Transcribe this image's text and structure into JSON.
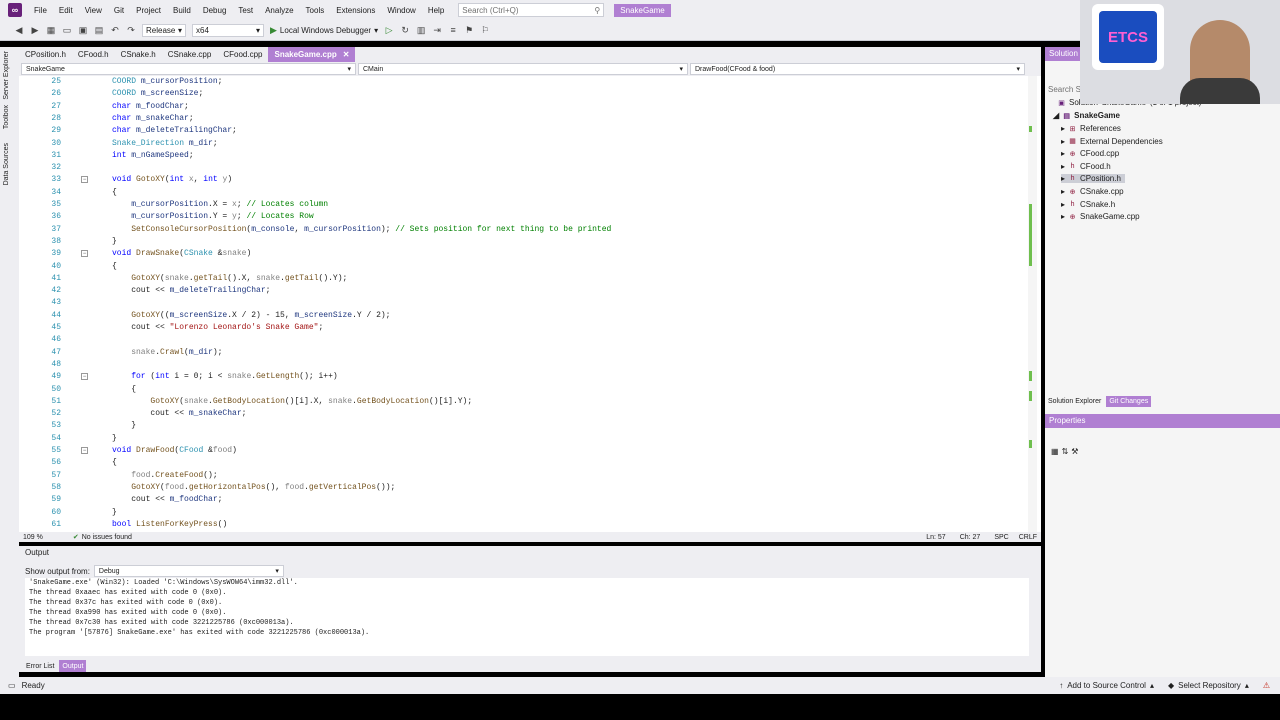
{
  "menu": [
    "File",
    "Edit",
    "View",
    "Git",
    "Project",
    "Build",
    "Debug",
    "Test",
    "Analyze",
    "Tools",
    "Extensions",
    "Window",
    "Help"
  ],
  "search_placeholder": "Search (Ctrl+Q)",
  "solution_name": "SnakeGame",
  "toolbar": {
    "config": "Release",
    "platform": "x64",
    "run_label": "Local Windows Debugger"
  },
  "left_tabs": [
    "Server Explorer",
    "Toolbox",
    "Data Sources"
  ],
  "tabs": [
    {
      "label": "CPosition.h",
      "active": false
    },
    {
      "label": "CFood.h",
      "active": false
    },
    {
      "label": "CSnake.h",
      "active": false
    },
    {
      "label": "CSnake.cpp",
      "active": false
    },
    {
      "label": "CFood.cpp",
      "active": false
    },
    {
      "label": "SnakeGame.cpp",
      "active": true
    }
  ],
  "navbar": {
    "project": "SnakeGame",
    "scope": "CMain",
    "member": "DrawFood(CFood & food)"
  },
  "code_lines": [
    {
      "n": "25",
      "html": "<span class=\"ty\">COORD</span> <span class=\"mb\">m_cursorPosition</span>;"
    },
    {
      "n": "26",
      "html": "<span class=\"ty\">COORD</span> <span class=\"mb\">m_screenSize</span>;"
    },
    {
      "n": "27",
      "html": "<span class=\"kw\">char</span> <span class=\"mb\">m_foodChar</span>;"
    },
    {
      "n": "28",
      "html": "<span class=\"kw\">char</span> <span class=\"mb\">m_snakeChar</span>;"
    },
    {
      "n": "29",
      "html": "<span class=\"kw\">char</span> <span class=\"mb\">m_deleteTrailingChar</span>;"
    },
    {
      "n": "30",
      "html": "<span class=\"ty\">Snake_Direction</span> <span class=\"mb\">m_dir</span>;"
    },
    {
      "n": "31",
      "html": "<span class=\"kw\">int</span> <span class=\"mb\">m_nGameSpeed</span>;"
    },
    {
      "n": "32",
      "html": ""
    },
    {
      "n": "33",
      "html": "<span class=\"kw\">void</span> <span class=\"fn\">GotoXY</span>(<span class=\"kw\">int</span> <span class=\"pm\">x</span>, <span class=\"kw\">int</span> <span class=\"pm\">y</span>)",
      "fold": true
    },
    {
      "n": "34",
      "html": "{"
    },
    {
      "n": "35",
      "html": "    <span class=\"mb\">m_cursorPosition</span>.X = <span class=\"pm\">x</span>; <span class=\"cm\">// Locates column</span>"
    },
    {
      "n": "36",
      "html": "    <span class=\"mb\">m_cursorPosition</span>.Y = <span class=\"pm\">y</span>; <span class=\"cm\">// Locates Row</span>"
    },
    {
      "n": "37",
      "html": "    <span class=\"fn\">SetConsoleCursorPosition</span>(<span class=\"mb\">m_console</span>, <span class=\"mb\">m_cursorPosition</span>); <span class=\"cm\">// Sets position for next thing to be printed</span>"
    },
    {
      "n": "38",
      "html": "}"
    },
    {
      "n": "39",
      "html": "<span class=\"kw\">void</span> <span class=\"fn\">DrawSnake</span>(<span class=\"ty\">CSnake</span> &amp;<span class=\"pm\">snake</span>)",
      "fold": true
    },
    {
      "n": "40",
      "html": "{"
    },
    {
      "n": "41",
      "html": "    <span class=\"fn\">GotoXY</span>(<span class=\"pm\">snake</span>.<span class=\"fn\">getTail</span>().X, <span class=\"pm\">snake</span>.<span class=\"fn\">getTail</span>().Y);"
    },
    {
      "n": "42",
      "html": "    cout &lt;&lt; <span class=\"mb\">m_deleteTrailingChar</span>;"
    },
    {
      "n": "43",
      "html": ""
    },
    {
      "n": "44",
      "html": "    <span class=\"fn\">GotoXY</span>((<span class=\"mb\">m_screenSize</span>.X / 2) - 15, <span class=\"mb\">m_screenSize</span>.Y / 2);"
    },
    {
      "n": "45",
      "html": "    cout &lt;&lt; <span class=\"str\">\"Lorenzo Leonardo's Snake Game\"</span>;"
    },
    {
      "n": "46",
      "html": ""
    },
    {
      "n": "47",
      "html": "    <span class=\"pm\">snake</span>.<span class=\"fn\">Crawl</span>(<span class=\"mb\">m_dir</span>);"
    },
    {
      "n": "48",
      "html": ""
    },
    {
      "n": "49",
      "html": "    <span class=\"kw\">for</span> (<span class=\"kw\">int</span> i = 0; i &lt; <span class=\"pm\">snake</span>.<span class=\"fn\">GetLength</span>(); i++)",
      "fold": true
    },
    {
      "n": "50",
      "html": "    {"
    },
    {
      "n": "51",
      "html": "        <span class=\"fn\">GotoXY</span>(<span class=\"pm\">snake</span>.<span class=\"fn\">GetBodyLocation</span>()[i].X, <span class=\"pm\">snake</span>.<span class=\"fn\">GetBodyLocation</span>()[i].Y);"
    },
    {
      "n": "52",
      "html": "        cout &lt;&lt; <span class=\"mb\">m_snakeChar</span>;"
    },
    {
      "n": "53",
      "html": "    }"
    },
    {
      "n": "54",
      "html": "}"
    },
    {
      "n": "55",
      "html": "<span class=\"kw\">void</span> <span class=\"fn\">DrawFood</span>(<span class=\"ty\">CFood</span> &amp;<span class=\"pm\">food</span>)",
      "fold": true
    },
    {
      "n": "56",
      "html": "{"
    },
    {
      "n": "57",
      "html": "    <span class=\"pm\">food</span>.<span class=\"fn\">CreateFood</span>();"
    },
    {
      "n": "58",
      "html": "    <span class=\"fn\">GotoXY</span>(<span class=\"pm\">food</span>.<span class=\"fn\">getHorizontalPos</span>(), <span class=\"pm\">food</span>.<span class=\"fn\">getVerticalPos</span>());"
    },
    {
      "n": "59",
      "html": "    cout &lt;&lt; <span class=\"mb\">m_foodChar</span>;"
    },
    {
      "n": "60",
      "html": "}"
    },
    {
      "n": "61",
      "html": "<span class=\"kw\">bool</span> <span class=\"fn\">ListenForKeyPress</span>()"
    }
  ],
  "editor_status": {
    "zoom": "109 %",
    "issues": "No issues found",
    "line": "Ln: 57",
    "col": "Ch: 27",
    "spc": "SPC",
    "crlf": "CRLF"
  },
  "output": {
    "title": "Output",
    "show_from_label": "Show output from:",
    "source": "Debug",
    "lines": [
      "'SnakeGame.exe' (Win32): Loaded 'C:\\Windows\\SysWOW64\\imm32.dll'.",
      "The thread 0xaaec has exited with code 0 (0x0).",
      "The thread 0x37c has exited with code 0 (0x0).",
      "The thread 0xa990 has exited with code 0 (0x0).",
      "The thread 0x7c30 has exited with code 3221225786 (0xc000013a).",
      "The program '[57876] SnakeGame.exe' has exited with code 3221225786 (0xc000013a)."
    ]
  },
  "bottom_tabs": [
    {
      "label": "Error List",
      "active": false
    },
    {
      "label": "Output",
      "active": true
    }
  ],
  "solution_explorer": {
    "title": "Solution",
    "search": "Search S",
    "solution_line": "Solution 'SnakeGame' (1 of 1 project)",
    "project": "SnakeGame",
    "items": [
      {
        "label": "References",
        "icon": "references-icon"
      },
      {
        "label": "External Dependencies",
        "icon": "dependencies-icon"
      },
      {
        "label": "CFood.cpp",
        "icon": "cpp-file-icon"
      },
      {
        "label": "CFood.h",
        "icon": "header-file-icon"
      },
      {
        "label": "CPosition.h",
        "icon": "header-file-icon",
        "selected": true
      },
      {
        "label": "CSnake.cpp",
        "icon": "cpp-file-icon"
      },
      {
        "label": "CSnake.h",
        "icon": "header-file-icon"
      },
      {
        "label": "SnakeGame.cpp",
        "icon": "cpp-file-icon"
      }
    ],
    "tabs": [
      {
        "label": "Solution Explorer",
        "active": false
      },
      {
        "label": "Git Changes",
        "active": true
      }
    ]
  },
  "properties": {
    "title": "Properties"
  },
  "status": {
    "ready": "Ready",
    "source_control": "Add to Source Control",
    "repository": "Select Repository"
  },
  "webcam": {
    "logo_text": "ETCS"
  },
  "colors": {
    "accent": "#b07fd2",
    "chrome": "#eeeef2",
    "keyword": "#0000ff",
    "type": "#2b91af",
    "comment": "#008000",
    "string": "#a31515"
  }
}
